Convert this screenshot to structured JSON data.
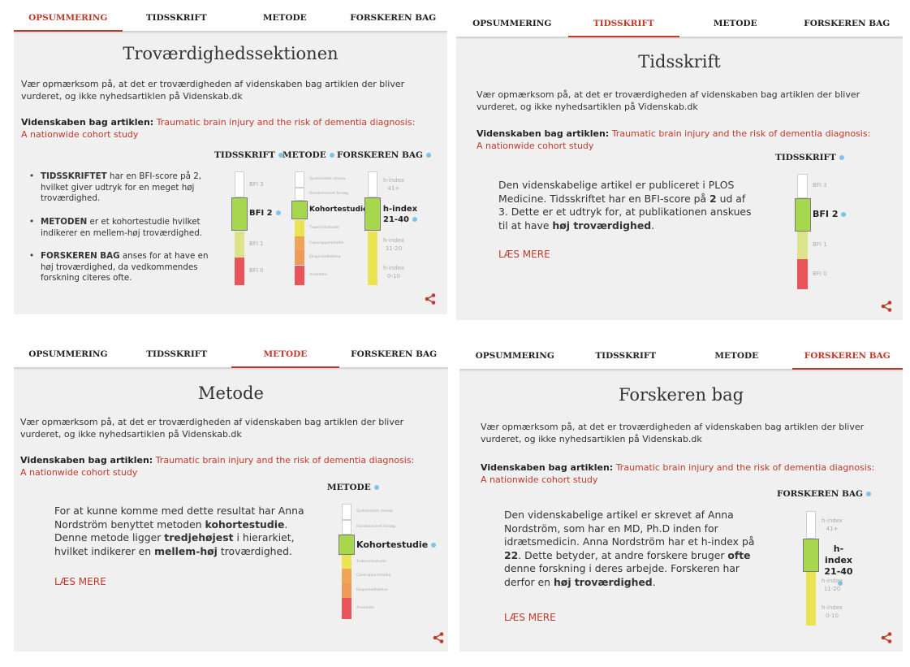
{
  "tabs": [
    "OPSUMMERING",
    "TIDSSKRIFT",
    "METODE",
    "FORSKEREN BAG"
  ],
  "intro": "Vær opmærksom på, at det er troværdigheden af videnskaben bag artiklen der bliver vurderet, og ikke nyhedsartiklen på Videnskab.dk",
  "article_label": "Videnskaben bag artiklen:",
  "article_title": "Traumatic brain injury and the risk of dementia diagnosis: A nationwide cohort study",
  "read_more": "LÆS MERE",
  "colors": {
    "accent": "#c0392b",
    "green": "#a6d74f",
    "lightgreen": "#dde38a",
    "yellow": "#ebe452",
    "orange": "#eea55a",
    "red": "#e8545a",
    "info_dot": "#7ec3e6"
  },
  "summary": {
    "title": "Troværdighedssektionen",
    "col_heads": [
      "TIDSSKRIFT",
      "METODE",
      "FORSKEREN BAG"
    ],
    "bullets": [
      {
        "bold": "TIDSSKRIFTET",
        "rest": " har en BFI-score på 2, hvilket giver udtryk for en meget høj troværdighed."
      },
      {
        "bold": "METODEN",
        "rest": " er et kohortestudie hvilket indikerer en mellem-høj troværdighed."
      },
      {
        "bold": "FORSKEREN BAG",
        "rest": " anses for at have en høj troværdighed, da vedkommendes forskning citeres ofte."
      }
    ]
  },
  "journal": {
    "title": "Tidsskrift",
    "head": "TIDSSKRIFT",
    "text_1": "Den videnskabelige artikel er publiceret i PLOS Medicine. Tidsskriftet har en BFI-score på ",
    "bold_1": "2",
    "text_2": " ud af 3. Dette er et udtryk for, at publikationen anskues til at have ",
    "bold_2": "høj troværdighed",
    "text_3": "."
  },
  "method": {
    "title": "Metode",
    "head": "METODE",
    "text_1": "For at kunne komme med dette resultat har Anna Nordström benyttet metoden ",
    "bold_1": "kohortestudie",
    "text_2": ". Denne metode ligger ",
    "bold_2": "tredjehøjest",
    "text_3": " i hierarkiet, hvilket indikerer en ",
    "bold_3": "mellem-høj",
    "text_4": " troværdighed."
  },
  "researcher": {
    "title": "Forskeren bag",
    "head": "FORSKEREN BAG",
    "text_1": "Den videnskabelige artikel er skrevet af Anna Nordström, som har en MD, Ph.D inden for idrætsmedicin. Anna Nordström har et h-index på ",
    "bold_1": "22",
    "text_2": ". Dette betyder, at andre forskere bruger ",
    "bold_2": "ofte",
    "text_3": " denne forskning i deres arbejde. Forskeren har derfor en ",
    "bold_3": "høj troværdighed",
    "text_4": "."
  },
  "scales": {
    "bfi": {
      "levels": [
        "BFI 3",
        "BFI 2",
        "BFI 1",
        "BFI 0"
      ],
      "colors": [
        "#ffffff",
        "#a6d74f",
        "#dde38a",
        "#e8545a"
      ],
      "selected": 1
    },
    "method": {
      "levels": [
        "Systematisk review",
        "Randomiseret forsøg",
        "Kohortestudie",
        "Tværsnitsstudie",
        "Caserapportstudie",
        "Ekspertudtalelse",
        "Anekdote"
      ],
      "colors": [
        "#ffffff",
        "#ffffff",
        "#a6d74f",
        "#ebe452",
        "#eea55a",
        "#ee9a5a",
        "#e8545a"
      ],
      "selected": 2
    },
    "hindex": {
      "levels": [
        "h-index 41+",
        "h-index 21-40",
        "h-index 11-20",
        "h-index 0-10"
      ],
      "colors": [
        "#ffffff",
        "#a6d74f",
        "#ebe452",
        "#ebe452"
      ],
      "selected": 1
    }
  }
}
